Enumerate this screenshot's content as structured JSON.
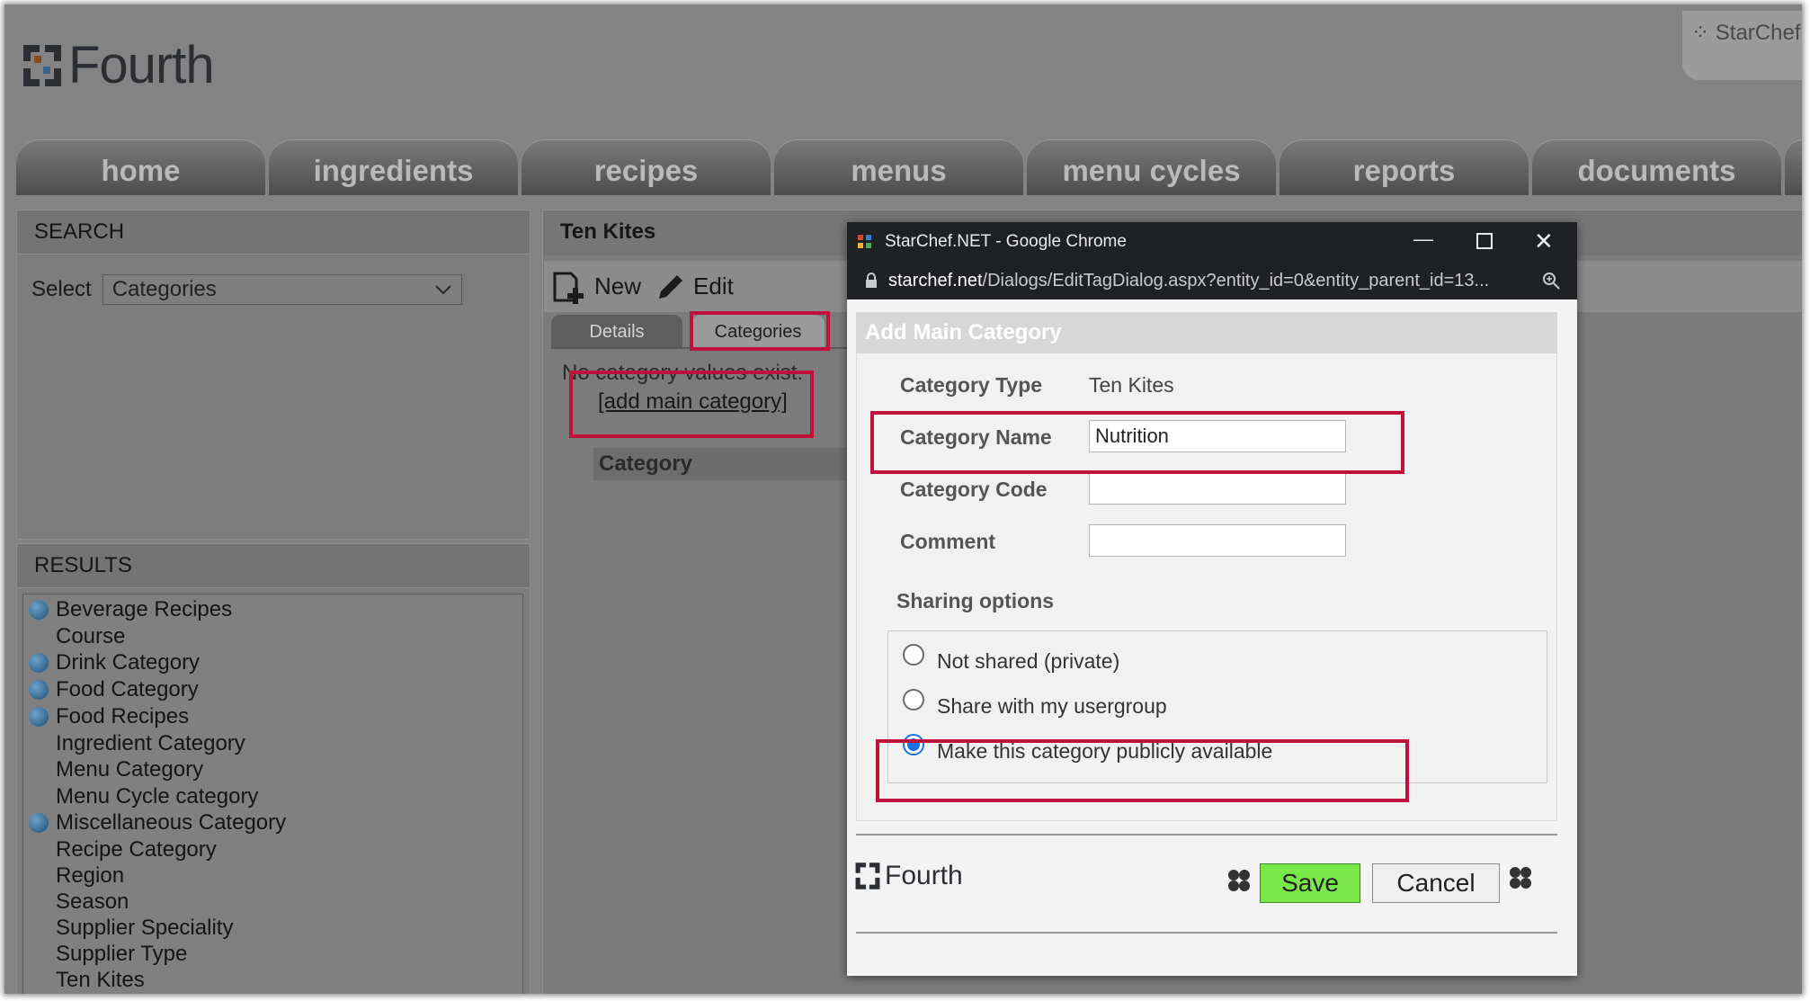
{
  "app": {
    "logo_text": "Fourth",
    "brand_badge": "StarChef"
  },
  "nav": {
    "tabs": [
      "home",
      "ingredients",
      "recipes",
      "menus",
      "menu cycles",
      "reports",
      "documents"
    ]
  },
  "search": {
    "header": "SEARCH",
    "select_label": "Select",
    "select_value": "Categories"
  },
  "results": {
    "header": "RESULTS",
    "items": [
      {
        "label": "Beverage Recipes",
        "globe": true
      },
      {
        "label": "Course",
        "globe": false
      },
      {
        "label": "Drink Category",
        "globe": true
      },
      {
        "label": "Food Category",
        "globe": true
      },
      {
        "label": "Food Recipes",
        "globe": true
      },
      {
        "label": "Ingredient Category",
        "globe": false
      },
      {
        "label": "Menu Category",
        "globe": false
      },
      {
        "label": "Menu Cycle category",
        "globe": false
      },
      {
        "label": "Miscellaneous Category",
        "globe": true
      },
      {
        "label": "Recipe Category",
        "globe": false
      },
      {
        "label": "Region",
        "globe": false
      },
      {
        "label": "Season",
        "globe": false
      },
      {
        "label": "Supplier Speciality",
        "globe": false
      },
      {
        "label": "Supplier Type",
        "globe": false
      },
      {
        "label": "Ten Kites",
        "globe": false
      }
    ]
  },
  "detail": {
    "title": "Ten Kites",
    "toolbar_new": "New",
    "toolbar_edit": "Edit",
    "tab_details": "Details",
    "tab_categories": "Categories",
    "empty_message": "No category values exist.",
    "add_link": "[add main category]",
    "column_header": "Category"
  },
  "browser": {
    "window_title": "StarChef.NET - Google Chrome",
    "url_domain": "starchef.net",
    "url_path": "/Dialogs/EditTagDialog.aspx?entity_id=0&entity_parent_id=13..."
  },
  "dialog": {
    "header": "Add Main Category",
    "category_type_label": "Category Type",
    "category_type_value": "Ten Kites",
    "category_name_label": "Category Name",
    "category_name_value": "Nutrition",
    "category_code_label": "Category Code",
    "category_code_value": "",
    "comment_label": "Comment",
    "comment_value": "",
    "sharing_label": "Sharing options",
    "options": [
      {
        "label": "Not shared (private)",
        "selected": false
      },
      {
        "label": "Share with my usergroup",
        "selected": false
      },
      {
        "label": "Make this category publicly available",
        "selected": true
      }
    ],
    "footer_logo": "Fourth",
    "save_label": "Save",
    "cancel_label": "Cancel"
  },
  "colors": {
    "highlight": "#c0103c",
    "save_green": "#7ae84a",
    "radio_selected": "#1a73e8"
  }
}
